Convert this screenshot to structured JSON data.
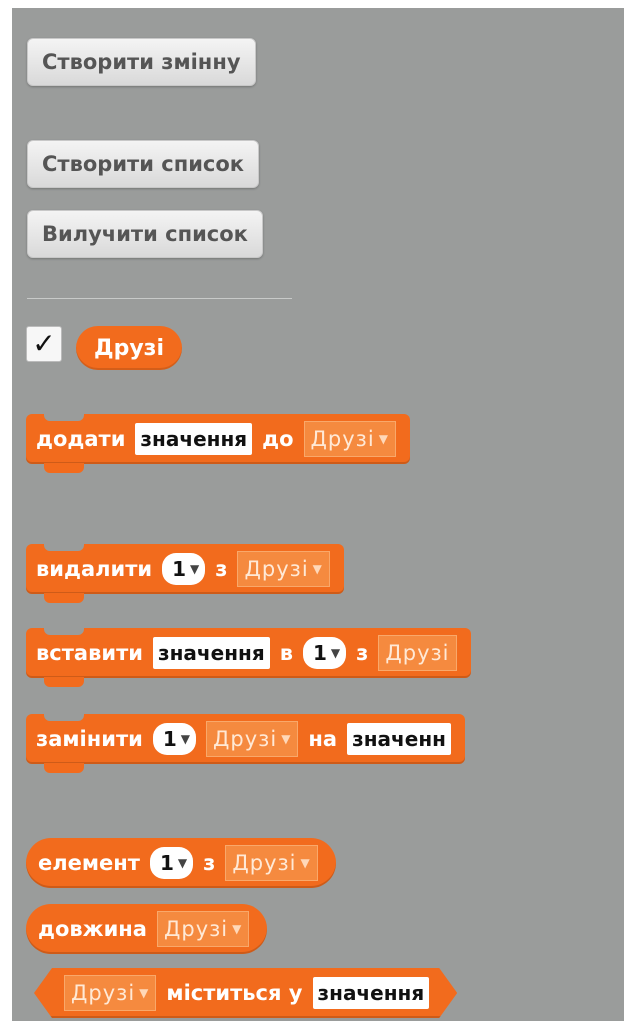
{
  "buttons": {
    "make_variable": "Створити змінну",
    "make_list": "Створити список",
    "delete_list": "Вилучити список"
  },
  "list": {
    "checked": true,
    "check_mark": "✓",
    "name": "Друзі"
  },
  "dropdown_arrow": "▼",
  "blocks": {
    "add": {
      "label": "додати",
      "value": "значення",
      "to": "до",
      "list": "Друзі"
    },
    "delete": {
      "label": "видалити",
      "index": "1",
      "from": "з",
      "list": "Друзі"
    },
    "insert": {
      "label": "вставити",
      "value": "значення",
      "at": "в",
      "index": "1",
      "of": "з",
      "list": "Друзі"
    },
    "replace": {
      "label": "замінити",
      "index": "1",
      "list": "Друзі",
      "with": "на",
      "value": "значенн"
    },
    "item": {
      "label": "елемент",
      "index": "1",
      "of": "з",
      "list": "Друзі"
    },
    "length": {
      "label": "довжина",
      "list": "Друзі"
    },
    "contains": {
      "list": "Друзі",
      "label": "міститься у",
      "value": "значення"
    }
  },
  "colors": {
    "palette_bg": "#9a9c9b",
    "list_block": "#f26b1d",
    "list_dropdown": "#f58a3f"
  }
}
